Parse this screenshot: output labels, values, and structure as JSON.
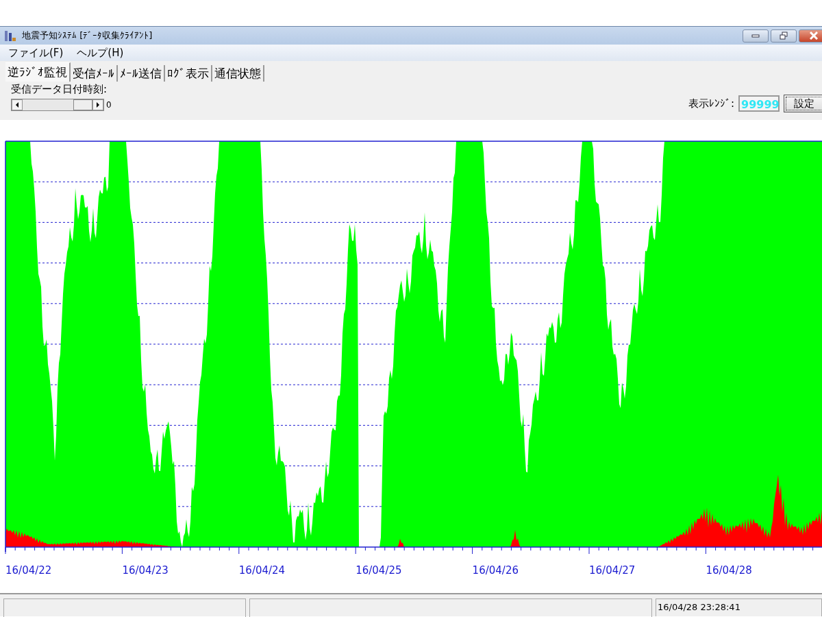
{
  "window": {
    "title": "地震予知ｼｽﾃﾑ [ﾃﾞｰﾀ収集ｸﾗｲｱﾝﾄ]"
  },
  "menu": [
    "ファイル(F)",
    "ヘルプ(H)"
  ],
  "tabs": [
    {
      "label": "逆ﾗｼﾞｵ監視",
      "selected": true
    },
    {
      "label": "受信ﾒｰﾙ",
      "selected": false
    },
    {
      "label": "ﾒｰﾙ送信",
      "selected": false
    },
    {
      "label": "ﾛｸﾞ表示",
      "selected": false
    },
    {
      "label": "通信状態",
      "selected": false
    }
  ],
  "controls": {
    "date_label": "受信データ日付時刻:",
    "scroll_reading": "0",
    "range_label": "表示ﾚﾝｼﾞ:",
    "range_value": "99999",
    "set_button": "設定"
  },
  "chart": {
    "x_labels": [
      "16/04/22",
      "16/04/23",
      "16/04/24",
      "16/04/25",
      "16/04/26",
      "16/04/27",
      "16/04/28"
    ]
  },
  "status_bar": {
    "time": "16/04/28 23:28:41"
  }
}
